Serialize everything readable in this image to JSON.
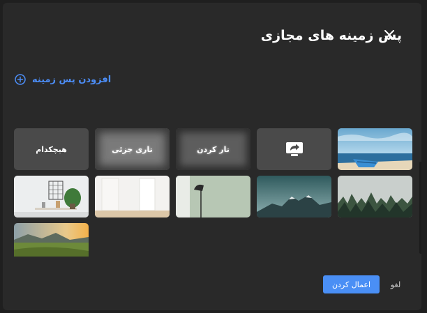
{
  "dialog": {
    "title": "پس زمینه های مجازی",
    "close_icon": "close-icon",
    "add_background_label": "افزودن پس زمینه",
    "add_icon": "plus-circle-icon"
  },
  "tiles": {
    "none_label": "هیچکدام",
    "slight_blur_label": "تاری جزئی",
    "blur_label": "تار کردن",
    "share_icon": "screen-share-icon"
  },
  "footer": {
    "apply_label": "اعمال کردن",
    "cancel_label": "لغو"
  },
  "colors": {
    "accent": "#4a8ff5",
    "dialog_bg": "#292929",
    "tile_bg": "#4a4a4a"
  }
}
